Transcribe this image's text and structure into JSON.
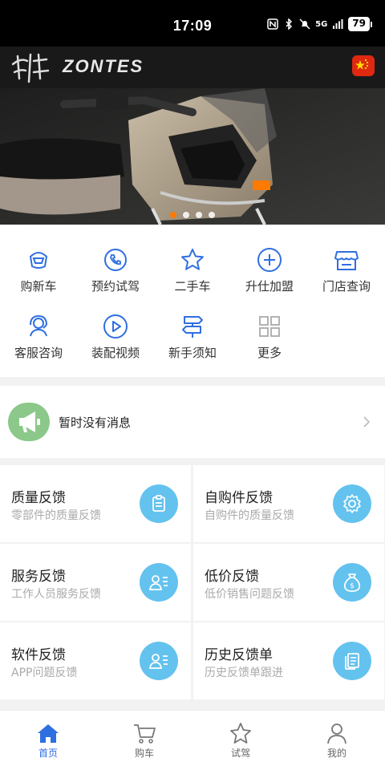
{
  "status_bar": {
    "time": "17:09",
    "network": "5G",
    "battery": "79"
  },
  "brand": {
    "name": "ZONTES",
    "accent": "#ff7a00"
  },
  "hero": {
    "slides": 4,
    "active_slide": 1
  },
  "quick_menu": [
    {
      "label": "购新车",
      "icon": "motorcycle-helmet-icon"
    },
    {
      "label": "预约试驾",
      "icon": "phone-icon"
    },
    {
      "label": "二手车",
      "icon": "star-icon"
    },
    {
      "label": "升仕加盟",
      "icon": "plus-circle-icon"
    },
    {
      "label": "门店查询",
      "icon": "store-icon"
    },
    {
      "label": "客服咨询",
      "icon": "headset-icon"
    },
    {
      "label": "装配视频",
      "icon": "play-icon"
    },
    {
      "label": "新手须知",
      "icon": "signpost-icon"
    },
    {
      "label": "更多",
      "icon": "grid-icon"
    }
  ],
  "notice": {
    "text": "暂时没有消息"
  },
  "feedback_cards": [
    {
      "title": "质量反馈",
      "subtitle": "零部件的质量反馈",
      "icon": "clipboard-icon"
    },
    {
      "title": "自购件反馈",
      "subtitle": "自购件的质量反馈",
      "icon": "gear-icon"
    },
    {
      "title": "服务反馈",
      "subtitle": "工作人员服务反馈",
      "icon": "person-card-icon"
    },
    {
      "title": "低价反馈",
      "subtitle": "低价销售问题反馈",
      "icon": "money-bag-icon"
    },
    {
      "title": "软件反馈",
      "subtitle": "APP问题反馈",
      "icon": "person-card-icon"
    },
    {
      "title": "历史反馈单",
      "subtitle": "历史反馈单跟进",
      "icon": "document-icon"
    }
  ],
  "bottom_nav": [
    {
      "label": "首页",
      "icon": "home-icon",
      "active": true
    },
    {
      "label": "购车",
      "icon": "cart-icon",
      "active": false
    },
    {
      "label": "试驾",
      "icon": "star-icon",
      "active": false
    },
    {
      "label": "我的",
      "icon": "user-icon",
      "active": false
    }
  ],
  "colors": {
    "icon_blue": "#2f6fe0",
    "card_icon_bg": "#64c2ee",
    "notice_green": "#8bc88a"
  }
}
